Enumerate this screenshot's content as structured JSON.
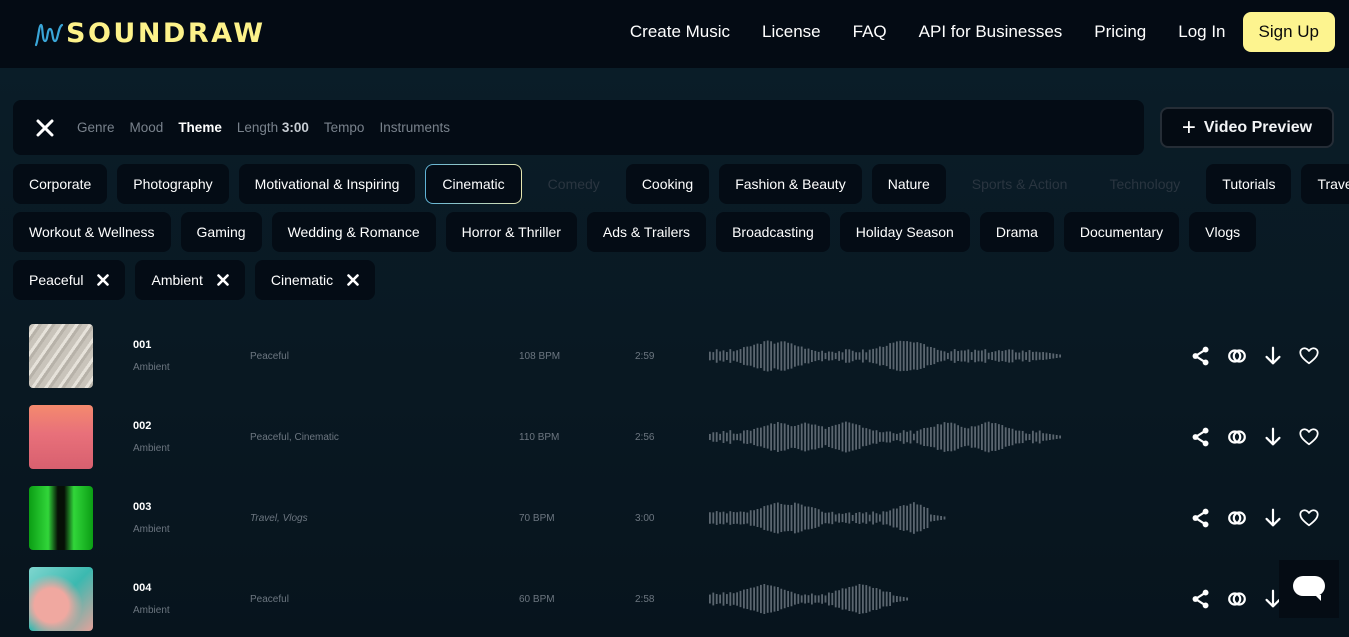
{
  "header": {
    "logo_text": "SOUNDRAW",
    "nav": [
      "Create Music",
      "License",
      "FAQ",
      "API for Businesses",
      "Pricing",
      "Log In"
    ],
    "signup_label": "Sign Up",
    "brand_color": "#fdf28a",
    "logo_wave_color": "#3aa6d8"
  },
  "filterbar": {
    "close_icon": "close-icon",
    "tabs": [
      {
        "label": "Genre",
        "active": false
      },
      {
        "label": "Mood",
        "active": false
      },
      {
        "label": "Theme",
        "active": true
      },
      {
        "label": "Length",
        "value": "3:00",
        "active": false
      },
      {
        "label": "Tempo",
        "active": false
      },
      {
        "label": "Instruments",
        "active": false
      }
    ],
    "video_preview_label": "Video Preview",
    "video_preview_icon": "plus-icon"
  },
  "themes": {
    "row1": [
      {
        "label": "Corporate",
        "state": "normal"
      },
      {
        "label": "Photography",
        "state": "normal"
      },
      {
        "label": "Motivational & Inspiring",
        "state": "normal"
      },
      {
        "label": "Cinematic",
        "state": "selected"
      },
      {
        "label": "Comedy",
        "state": "disabled"
      },
      {
        "label": "Cooking",
        "state": "normal"
      },
      {
        "label": "Fashion & Beauty",
        "state": "normal"
      },
      {
        "label": "Nature",
        "state": "normal"
      },
      {
        "label": "Sports & Action",
        "state": "disabled"
      },
      {
        "label": "Technology",
        "state": "disabled"
      },
      {
        "label": "Tutorials",
        "state": "normal"
      },
      {
        "label": "Travel",
        "state": "normal"
      }
    ],
    "row2": [
      {
        "label": "Workout & Wellness"
      },
      {
        "label": "Gaming"
      },
      {
        "label": "Wedding & Romance"
      },
      {
        "label": "Horror & Thriller"
      },
      {
        "label": "Ads & Trailers"
      },
      {
        "label": "Broadcasting"
      },
      {
        "label": "Holiday Season"
      },
      {
        "label": "Drama"
      },
      {
        "label": "Documentary"
      },
      {
        "label": "Vlogs"
      }
    ]
  },
  "active_filters": [
    {
      "label": "Peaceful"
    },
    {
      "label": "Ambient"
    },
    {
      "label": "Cinematic"
    }
  ],
  "tracks": [
    {
      "number": "001",
      "genre": "Ambient",
      "tags": "Peaceful",
      "tags_italic": false,
      "bpm": "108 BPM",
      "length": "2:59",
      "thumb": "sand-dunes",
      "wave_length_fraction": 1.0
    },
    {
      "number": "002",
      "genre": "Ambient",
      "tags": "Peaceful, Cinematic",
      "tags_italic": false,
      "bpm": "110 BPM",
      "length": "2:56",
      "thumb": "pink-clouds",
      "wave_length_fraction": 1.0
    },
    {
      "number": "003",
      "genre": "Ambient",
      "tags": "Travel, Vlogs",
      "tags_italic": true,
      "bpm": "70 BPM",
      "length": "3:00",
      "thumb": "green-tunnel",
      "wave_length_fraction": 0.67
    },
    {
      "number": "004",
      "genre": "Ambient",
      "tags": "Peaceful",
      "tags_italic": false,
      "bpm": "60 BPM",
      "length": "2:58",
      "thumb": "teal-sky-clouds",
      "wave_length_fraction": 0.57
    }
  ],
  "track_actions": [
    "share-icon",
    "link-rings-icon",
    "download-icon",
    "heart-icon"
  ],
  "chat_widget": "chat-bubble-icon"
}
